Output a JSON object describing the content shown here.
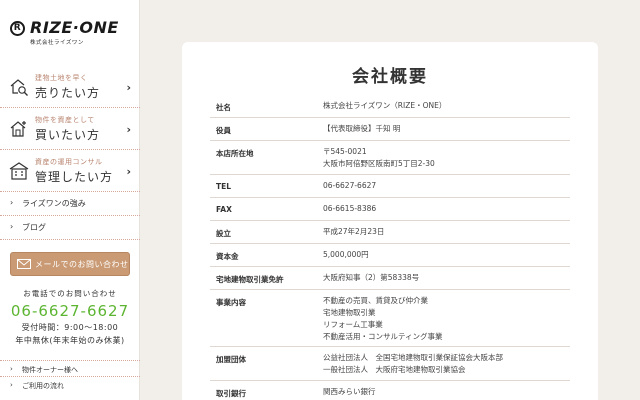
{
  "logo": {
    "name": "RIZE·ONE",
    "mark": "R",
    "sub": "株式会社ライズワン"
  },
  "sidebar": {
    "menu": [
      {
        "sub": "建物土地を早く",
        "label": "売りたい方"
      },
      {
        "sub": "物件を資産として",
        "label": "買いたい方"
      },
      {
        "sub": "資産の運用コンサル",
        "label": "管理したい方"
      }
    ],
    "links": [
      {
        "label": "ライズワンの強み"
      },
      {
        "label": "ブログ"
      }
    ],
    "mail_button": "メールでのお問い合わせ",
    "tel": {
      "caption": "お電話でのお問い合わせ",
      "number": "06-6627-6627",
      "hours": "受付時間：9:00～18:00",
      "holiday": "年中無休(年末年始のみ休業)"
    },
    "bottom_links": [
      {
        "label": "物件オーナー様へ"
      },
      {
        "label": "ご利用の流れ"
      }
    ]
  },
  "main": {
    "title": "会社概要",
    "rows": [
      {
        "key": "社名",
        "values": [
          "株式会社ライズワン（RIZE・ONE）"
        ]
      },
      {
        "key": "役員",
        "values": [
          "【代表取締役】千知 明"
        ]
      },
      {
        "key": "本店所在地",
        "values": [
          "〒545-0021",
          "大阪市阿倍野区阪南町5丁目2-30"
        ]
      },
      {
        "key": "TEL",
        "values": [
          "06-6627-6627"
        ]
      },
      {
        "key": "FAX",
        "values": [
          "06-6615-8386"
        ]
      },
      {
        "key": "設立",
        "values": [
          "平成27年2月23日"
        ]
      },
      {
        "key": "資本金",
        "values": [
          "5,000,000円"
        ]
      },
      {
        "key": "宅地建物取引業免許",
        "values": [
          "大阪府知事（2）第58338号"
        ]
      },
      {
        "key": "事業内容",
        "values": [
          "不動産の売買、賃貸及び仲介業",
          "宅地建物取引業",
          "リフォーム工事業",
          "不動産活用・コンサルティング事業"
        ]
      },
      {
        "key": "加盟団体",
        "values": [
          "公益社団法人　全国宅地建物取引業保証協会大阪本部",
          "一般社団法人　大阪府宅地建物取引業協会"
        ]
      },
      {
        "key": "取引銀行",
        "values": [
          "関西みらい銀行"
        ]
      }
    ]
  },
  "colors": {
    "accent": "#c99a74",
    "tel": "#5cb531",
    "divider": "#d8a89c",
    "background": "#f2eeea"
  }
}
